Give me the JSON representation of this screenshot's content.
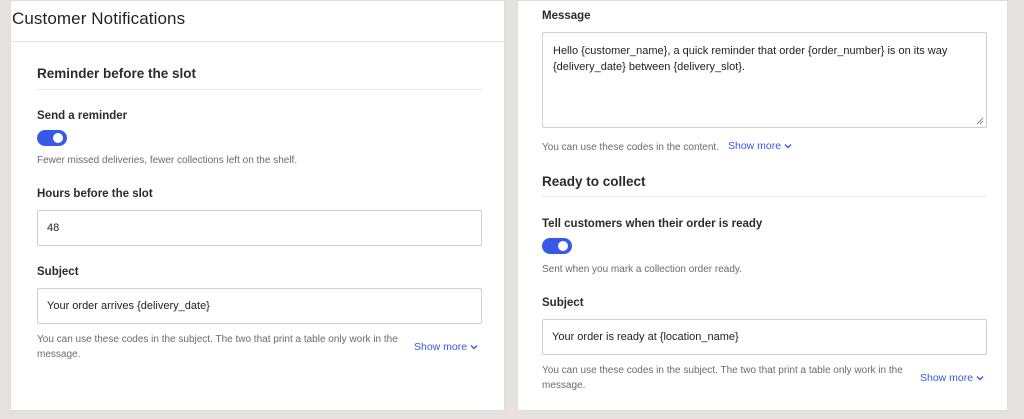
{
  "page": {
    "title": "Customer Notifications"
  },
  "reminder": {
    "heading": "Reminder before the slot",
    "send_label": "Send a reminder",
    "send_enabled": true,
    "send_help": "Fewer missed deliveries, fewer collections left on the shelf.",
    "hours_label": "Hours before the slot",
    "hours_value": "48",
    "subject_label": "Subject",
    "subject_value": "Your order arrives {delivery_date}",
    "subject_help": "You can use these codes in the subject. The two that print a table only work in the message.",
    "show_more": "Show more",
    "message_label": "Message",
    "message_value": "Hello {customer_name}, a quick reminder that order {order_number} is on its way {delivery_date} between {delivery_slot}.",
    "message_help": "You can use these codes in the content.",
    "message_show_more": "Show more"
  },
  "ready": {
    "heading": "Ready to collect",
    "tell_label": "Tell customers when their order is ready",
    "tell_enabled": true,
    "tell_help": "Sent when you mark a collection order ready.",
    "subject_label": "Subject",
    "subject_value": "Your order is ready at {location_name}",
    "subject_help": "You can use these codes in the subject. The two that print a table only work in the message.",
    "show_more": "Show more"
  },
  "colors": {
    "accent": "#3858e9",
    "background": "#e7e2e0",
    "panel": "#ffffff"
  },
  "icons": {
    "show_more": "chevron-down-icon",
    "resize": "resize-handle-icon"
  }
}
